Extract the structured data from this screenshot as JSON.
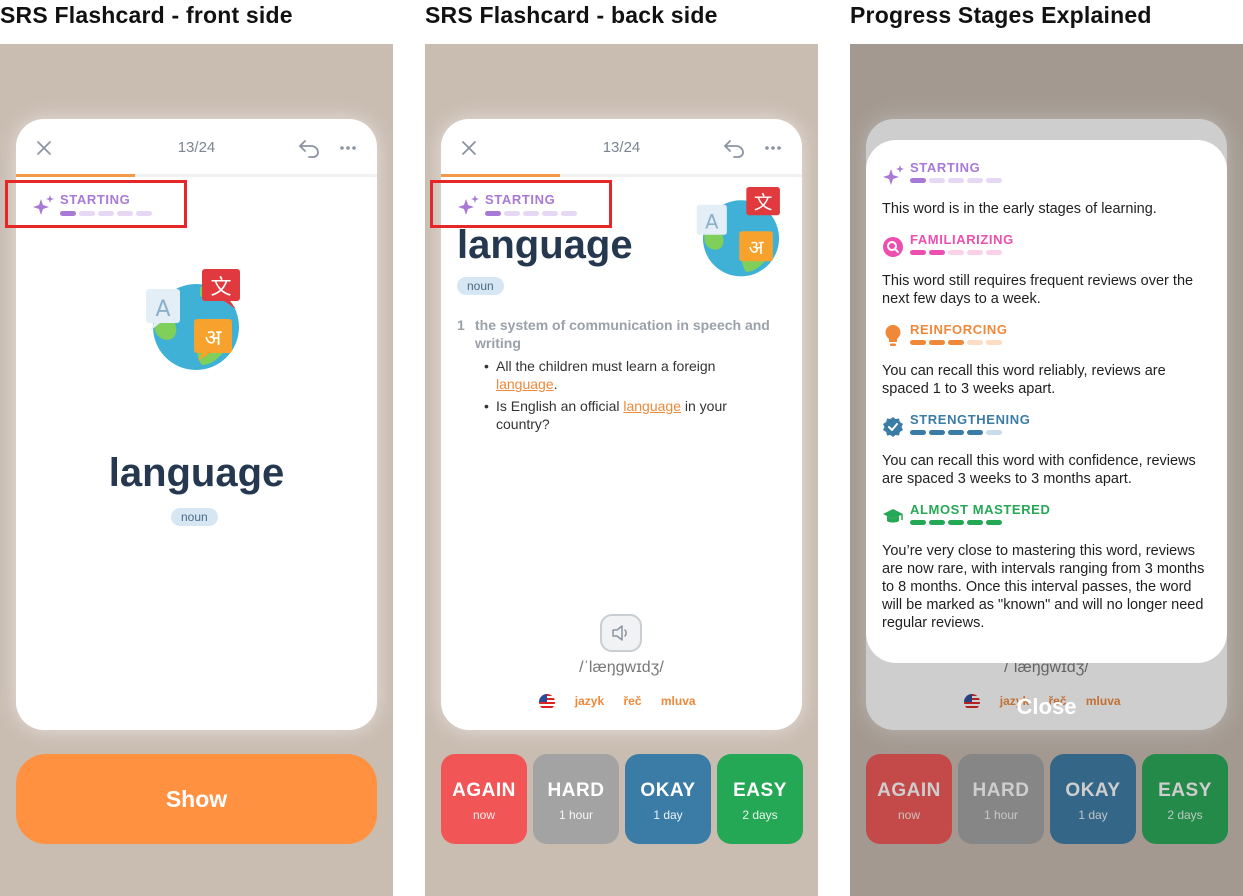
{
  "sections": [
    {
      "title": "SRS Flashcard - front side"
    },
    {
      "title": "SRS Flashcard - back side"
    },
    {
      "title": "Progress Stages Explained"
    }
  ],
  "card": {
    "counter": "13/24",
    "progress_fraction": 0.33,
    "stage_label": "STARTING",
    "stage_level": 1,
    "stage_total": 5,
    "word": "language",
    "part_of_speech": "noun",
    "definition_number": "1",
    "definition": "the system of communication in speech and writing",
    "examples": [
      {
        "before": "All the children must learn a foreign ",
        "highlight": "language",
        "after": "."
      },
      {
        "before": "Is English an official ",
        "highlight": "language",
        "after": " in your country?"
      }
    ],
    "phonetic": "/ˈlæŋɡwɪdʒ/",
    "translations": [
      "jazyk",
      "řeč",
      "mluva"
    ],
    "icons": {
      "close": "close-icon",
      "undo": "undo-icon",
      "more": "more-icon",
      "speaker": "speaker-icon",
      "flag": "us-flag-icon",
      "illustration": "language-globe-illustration"
    }
  },
  "front": {
    "show_label": "Show"
  },
  "grades": [
    {
      "label": "AGAIN",
      "sub": "now",
      "color": "#f25555"
    },
    {
      "label": "HARD",
      "sub": "1 hour",
      "color": "#a3a3a3"
    },
    {
      "label": "OKAY",
      "sub": "1 day",
      "color": "#3a7ca5"
    },
    {
      "label": "EASY",
      "sub": "2 days",
      "color": "#25a855"
    }
  ],
  "stages_modal": {
    "close_label": "Close",
    "stages": [
      {
        "label": "STARTING",
        "level": 1,
        "color": "#a879d6",
        "light": "#e6d7f4",
        "icon": "sparkles-icon",
        "desc": "This word is in the early stages of learning."
      },
      {
        "label": "FAMILIARIZING",
        "level": 2,
        "color": "#ec4fb0",
        "light": "#fbd1ea",
        "icon": "magnifier-icon",
        "desc": "This word still requires frequent reviews over the next few days to a week."
      },
      {
        "label": "REINFORCING",
        "level": 3,
        "color": "#f0883a",
        "light": "#fcdcc2",
        "icon": "lightbulb-icon",
        "desc": "You can recall this word reliably, reviews are spaced 1 to 3 weeks apart."
      },
      {
        "label": "STRENGTHENING",
        "level": 4,
        "color": "#3a7ca5",
        "light": "#c8dcea",
        "icon": "badge-check-icon",
        "desc": "You can recall this word with confidence, reviews are spaced 3 weeks to 3 months apart."
      },
      {
        "label": "ALMOST MASTERED",
        "level": 5,
        "color": "#25a855",
        "light": "#c5ebd3",
        "icon": "graduation-cap-icon",
        "desc": "You’re very close to mastering this word, reviews are now rare, with intervals ranging from 3 months to 8 months. Once this interval passes, the word will be marked as \"known\" and will no longer need regular reviews."
      }
    ]
  },
  "colors": {
    "accent": "#ff9140",
    "stage_purple": "#a879d6",
    "highlight_box": "#e52727",
    "word": "#25384f"
  }
}
